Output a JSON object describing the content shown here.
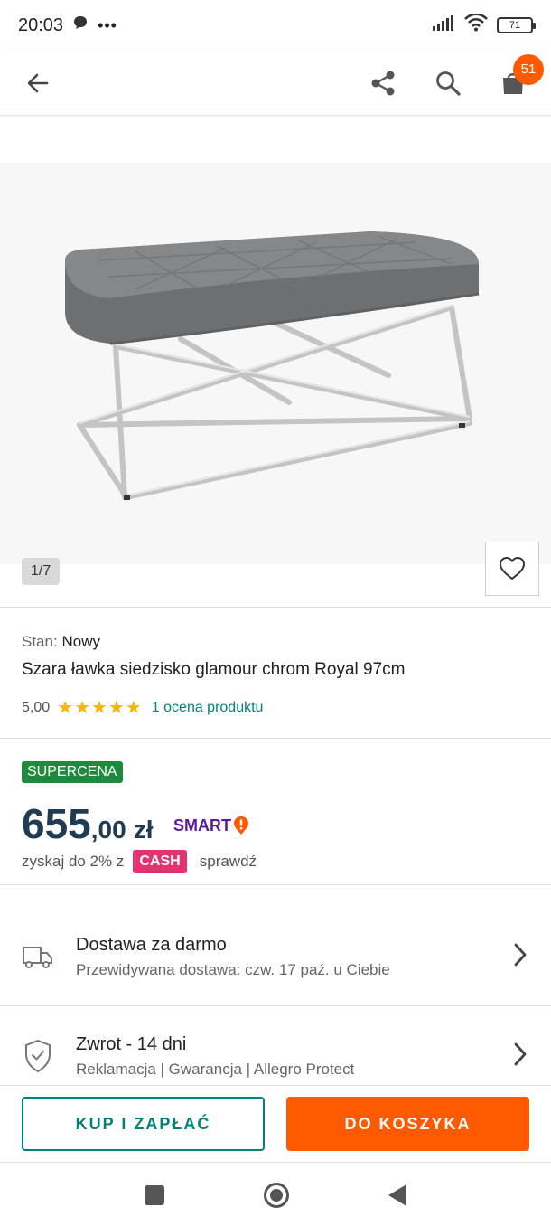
{
  "status": {
    "time": "20:03",
    "battery": "71",
    "icons": [
      "message-icon",
      "more-dots-icon",
      "signal-icon",
      "wifi-icon",
      "battery-icon"
    ]
  },
  "appbar": {
    "icons": [
      "back-arrow-icon",
      "share-icon",
      "search-icon",
      "cart-icon"
    ],
    "cart_count": "51"
  },
  "gallery": {
    "counter": "1/7"
  },
  "product": {
    "condition_label": "Stan:",
    "condition_value": "Nowy",
    "title": "Szara ławka siedzisko glamour chrom Royal 97cm",
    "rating_value": "5,00",
    "stars": "★★★★★",
    "rating_link": "1 ocena produktu"
  },
  "pricing": {
    "badge": "SUPERCENA",
    "price_whole": "655",
    "price_decimal": ",00",
    "currency": "zł",
    "smart_label": "SMART",
    "cashback_prefix": "zyskaj do 2% z",
    "cash_badge": "CASH",
    "cashback_link": "sprawdź"
  },
  "delivery": {
    "title": "Dostawa za darmo",
    "subtitle": "Przewidywana dostawa: czw. 17 paź. u Ciebie"
  },
  "returns": {
    "title": "Zwrot - 14 dni",
    "subtitle": "Reklamacja | Gwarancja | Allegro Protect"
  },
  "actions": {
    "buy_now": "KUP I ZAPŁAĆ",
    "add_to_cart": "DO KOSZYKA"
  },
  "colors": {
    "accent_teal": "#00817a",
    "brand_orange": "#ff5a00",
    "supercena_green": "#1e8a3e",
    "cash_pink": "#e5336f",
    "price_blue": "#1f3c52"
  }
}
